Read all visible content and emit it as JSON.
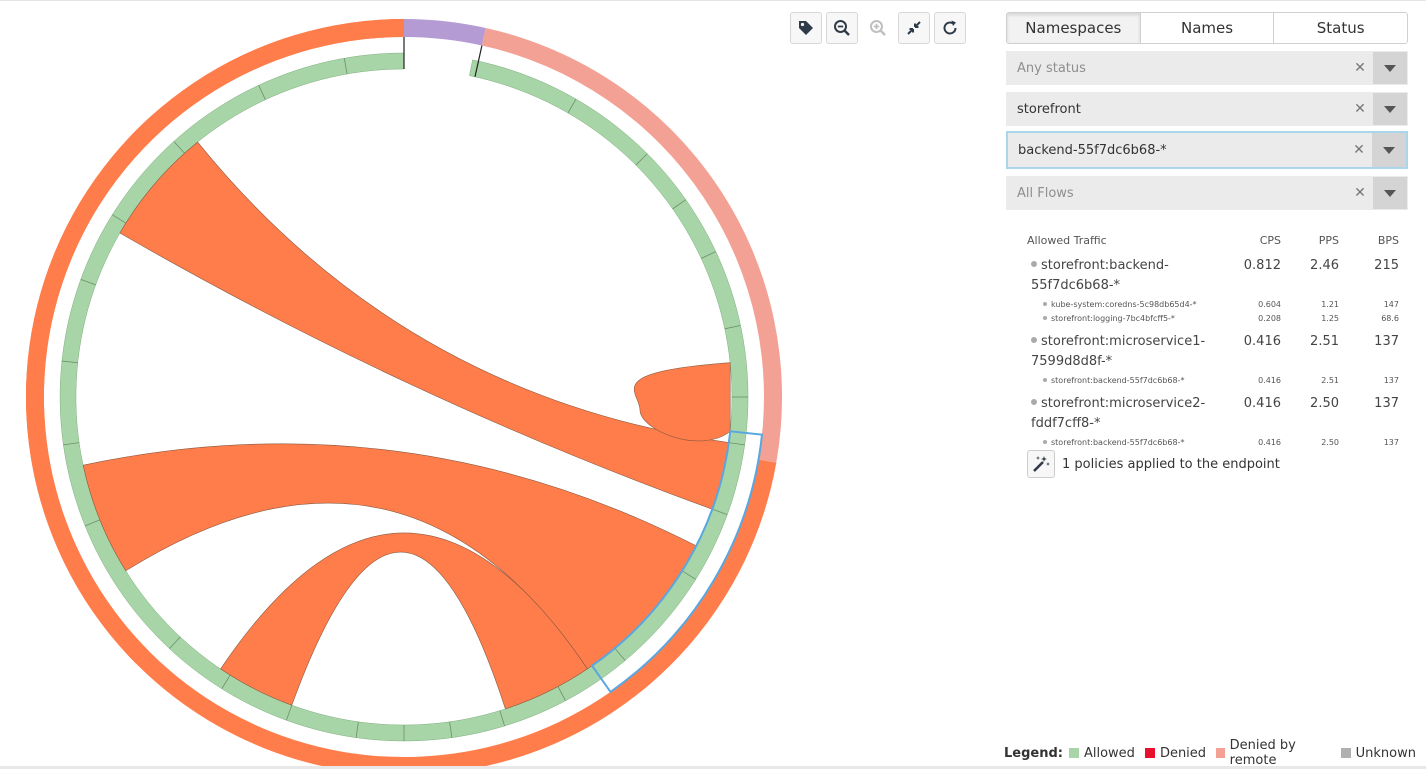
{
  "toolbar": {
    "tag_icon": "tag-icon",
    "zoom_out_icon": "zoom-out-icon",
    "zoom_in_icon": "zoom-in-icon",
    "collapse_icon": "collapse-icon",
    "refresh_icon": "refresh-icon"
  },
  "tabs": [
    {
      "label": "Namespaces",
      "active": true
    },
    {
      "label": "Names",
      "active": false
    },
    {
      "label": "Status",
      "active": false
    }
  ],
  "filters": {
    "status": {
      "placeholder": "Any status",
      "value": ""
    },
    "namespace": {
      "value": "storefront"
    },
    "name": {
      "value": "backend-55f7dc6b68-*"
    },
    "flows": {
      "placeholder": "All Flows",
      "value": ""
    }
  },
  "traffic": {
    "title": "Allowed Traffic",
    "col_cps": "CPS",
    "col_pps": "PPS",
    "col_bps": "BPS",
    "groups": [
      {
        "name_line1": "storefront:backend-",
        "name_line2": "55f7dc6b68-*",
        "cps": "0.812",
        "pps": "2.46",
        "bps": "215",
        "subs": [
          {
            "name": "kube-system:coredns-5c98db65d4-*",
            "cps": "0.604",
            "pps": "1.21",
            "bps": "147"
          },
          {
            "name": "storefront:logging-7bc4bfcff5-*",
            "cps": "0.208",
            "pps": "1.25",
            "bps": "68.6"
          }
        ]
      },
      {
        "name_line1": "storefront:microservice1-",
        "name_line2": "7599d8d8f-*",
        "cps": "0.416",
        "pps": "2.51",
        "bps": "137",
        "subs": [
          {
            "name": "storefront:backend-55f7dc6b68-*",
            "cps": "0.416",
            "pps": "2.51",
            "bps": "137"
          }
        ]
      },
      {
        "name_line1": "storefront:microservice2-",
        "name_line2": "fddf7cff8-*",
        "cps": "0.416",
        "pps": "2.50",
        "bps": "137",
        "subs": [
          {
            "name": "storefront:backend-55f7dc6b68-*",
            "cps": "0.416",
            "pps": "2.50",
            "bps": "137"
          }
        ]
      }
    ]
  },
  "policy": {
    "label": "1 policies applied to the endpoint",
    "icon": "magic-wand-icon"
  },
  "legend": {
    "title": "Legend:",
    "items": [
      {
        "label": "Allowed",
        "color": "#a8d5a8"
      },
      {
        "label": "Denied",
        "color": "#e8112d"
      },
      {
        "label": "Denied by remote",
        "color": "#f4a195"
      },
      {
        "label": "Unknown",
        "color": "#b0b0b0"
      }
    ]
  },
  "colors": {
    "namespace_storefront": "#ff7d4b",
    "namespace_system": "#b49bd4",
    "namespace_remote": "#f4a195",
    "ring_gray": "#d6d6d6",
    "allowed": "#a8d5a8",
    "chord": "#ff7d4b",
    "highlight": "#58a7e0"
  }
}
